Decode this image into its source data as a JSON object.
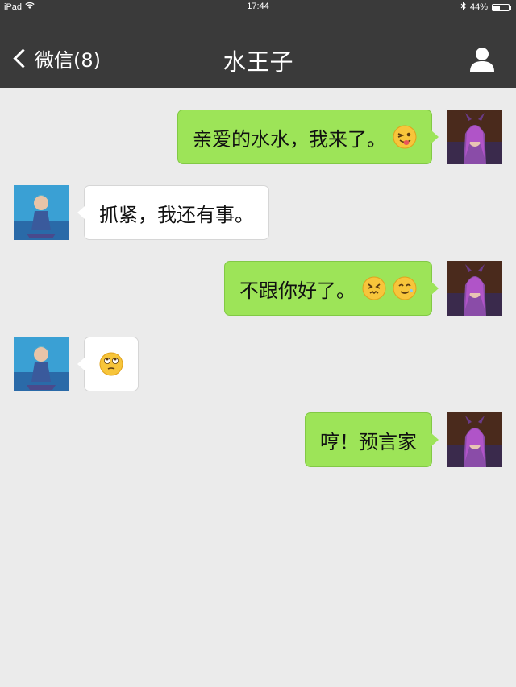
{
  "status_bar": {
    "device": "iPad",
    "time": "17:44",
    "battery": "44%",
    "battery_level": 0.44
  },
  "nav": {
    "back_label": "微信(8)",
    "title": "水王子",
    "profile_icon": "person-icon"
  },
  "messages": [
    {
      "side": "right",
      "sender": "me",
      "text": "亲爱的水水，我来了。",
      "emoji": [
        "wink-tongue-emoji"
      ]
    },
    {
      "side": "left",
      "sender": "other",
      "text": "抓紧，我还有事。",
      "emoji": []
    },
    {
      "side": "right",
      "sender": "me",
      "text": "不跟你好了。",
      "emoji": [
        "confounded-emoji",
        "grimace-emoji"
      ]
    },
    {
      "side": "left",
      "sender": "other",
      "text": "",
      "emoji": [
        "eye-roll-emoji"
      ]
    },
    {
      "side": "right",
      "sender": "me",
      "text": "哼！预言家",
      "emoji": []
    }
  ],
  "colors": {
    "navbar": "#3a3a3a",
    "background": "#ebebeb",
    "outgoing_bubble": "#9de458",
    "incoming_bubble": "#ffffff"
  }
}
